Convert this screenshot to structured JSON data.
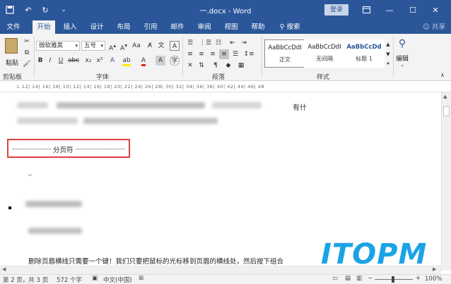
{
  "titlebar": {
    "title": "一.docx - Word",
    "login_label": "登录",
    "save_icon": "save-icon",
    "undo_icon": "undo-icon",
    "redo_icon": "redo-icon"
  },
  "tabs": [
    {
      "label": "文件",
      "active": false
    },
    {
      "label": "开始",
      "active": true
    },
    {
      "label": "插入",
      "active": false
    },
    {
      "label": "设计",
      "active": false
    },
    {
      "label": "布局",
      "active": false
    },
    {
      "label": "引用",
      "active": false
    },
    {
      "label": "邮件",
      "active": false
    },
    {
      "label": "审阅",
      "active": false
    },
    {
      "label": "视图",
      "active": false
    },
    {
      "label": "帮助",
      "active": false
    },
    {
      "label": "搜索",
      "active": false
    }
  ],
  "share_label": "共享",
  "ribbon": {
    "paste_label": "粘贴",
    "clipboard_label": "剪贴板",
    "font_name": "微软雅黑",
    "font_size": "五号",
    "font_group_label": "字体",
    "paragraph_group_label": "段落",
    "styles_group_label": "样式",
    "styles": [
      {
        "preview": "AaBbCcDdI",
        "name": "正文"
      },
      {
        "preview": "AaBbCcDdI",
        "name": "无间隔"
      },
      {
        "preview": "AaBbCcDd",
        "name": "标题 1"
      }
    ],
    "edit_label": "编辑"
  },
  "ruler": {
    "ticks": "L  12|  14|  16|  18|  10|  12|  14|  16|  18|  20|  22|  24|  26|  28|  30|  32|  34|  36|  38|  40|  42|  44|  46|  48"
  },
  "document": {
    "line1_tail": "有什",
    "page_break_label": "分页符",
    "bottom_paragraph": "删除页眉横线只需要一个键！我们只要把鼠标的光标移到页眉的横线处，然后按下组合"
  },
  "watermark": "ITOPM",
  "status": {
    "page": "第 2 页，共 3 页",
    "words": "572 个字",
    "language": "中文(中国)",
    "zoom": "100%"
  },
  "colors": {
    "accent": "#2b579a",
    "highlight_box": "#d9423f",
    "watermark": "#1ba3e6"
  }
}
